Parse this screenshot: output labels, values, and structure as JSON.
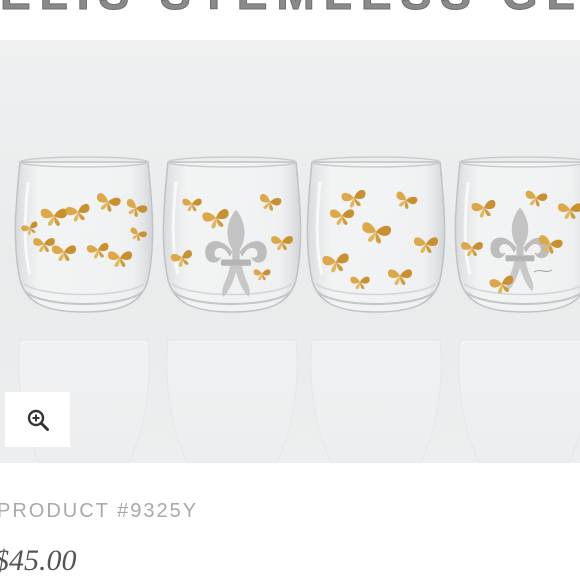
{
  "page": {
    "title": "ELIS STEMLESS GLASSES"
  },
  "gallery": {
    "image_alt": "Set of four stemless wine glasses decorated with gold butterflies and silver fleur-de-lis",
    "zoom_icon": "zoom-in-icon"
  },
  "product": {
    "number": "PRODUCT #9325Y",
    "price": "$45.00"
  },
  "colors": {
    "gold": "#d9a640",
    "silver": "#b9b9b9",
    "gallery_bg": "#eceeef",
    "price_text": "#555555",
    "meta_text": "#a9a9a9"
  }
}
